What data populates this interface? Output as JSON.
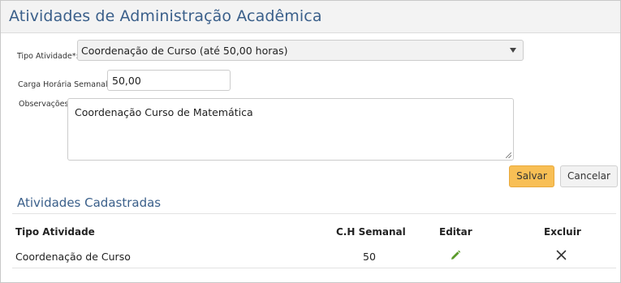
{
  "page": {
    "title": "Atividades de Administração Acadêmica"
  },
  "form": {
    "tipo_label": "Tipo Atividade*:",
    "tipo_value": "Coordenação de Curso (até 50,00 horas)",
    "carga_label": "Carga Horária Semanal*:",
    "carga_value": "50,00",
    "obs_label": "Observações:",
    "obs_value": "Coordenação Curso de Matemática",
    "save_label": "Salvar",
    "cancel_label": "Cancelar"
  },
  "list": {
    "title": "Atividades Cadastradas",
    "headers": {
      "tipo": "Tipo Atividade",
      "ch": "C.H Semanal",
      "editar": "Editar",
      "excluir": "Excluir"
    },
    "rows": [
      {
        "tipo": "Coordenação de Curso",
        "ch": "50",
        "edit_icon": "pencil-icon",
        "delete_icon": "close-icon"
      }
    ]
  },
  "colors": {
    "accent": "#3a5f8a",
    "save_button": "#f8bf55",
    "edit_icon": "#5a9a2a"
  }
}
